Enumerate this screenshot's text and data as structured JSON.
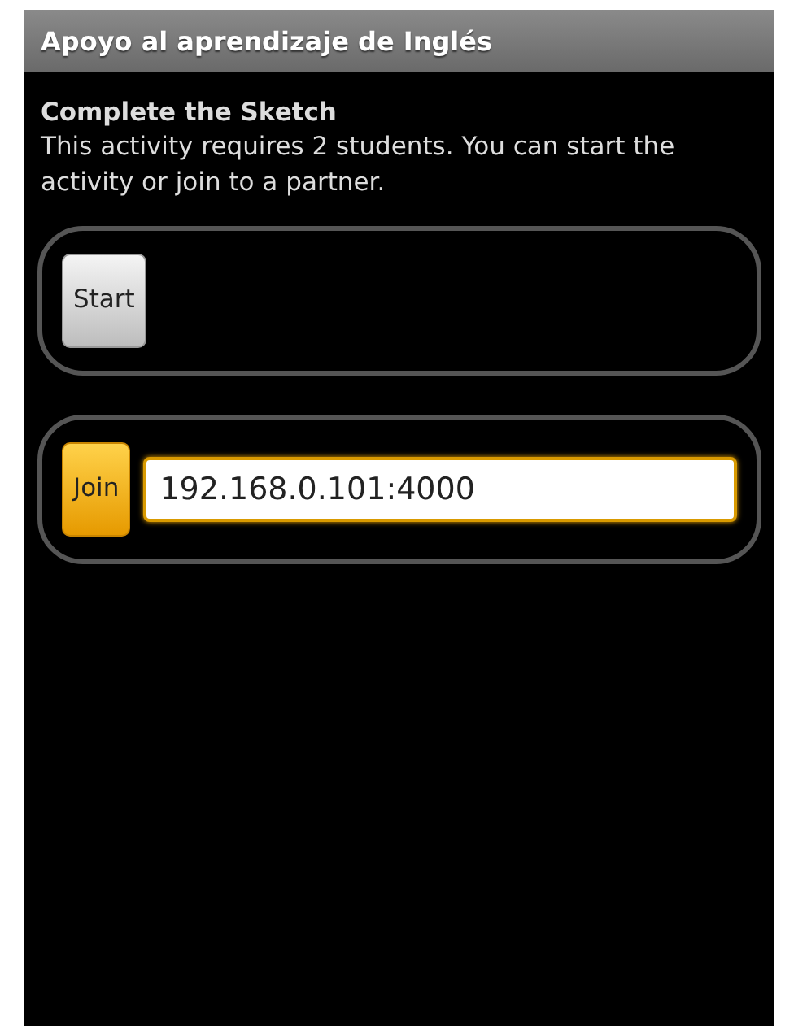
{
  "window": {
    "title": "Apoyo al aprendizaje de Inglés"
  },
  "heading": "Complete the Sketch",
  "description": "This activity requires 2 students. You can start the activity or join to a partner.",
  "panels": [
    {
      "button": {
        "label": "Start",
        "focused": false
      }
    },
    {
      "button": {
        "label": "Join",
        "focused": true
      },
      "field": {
        "value": "192.168.0.101:4000",
        "focused": true
      }
    }
  ]
}
